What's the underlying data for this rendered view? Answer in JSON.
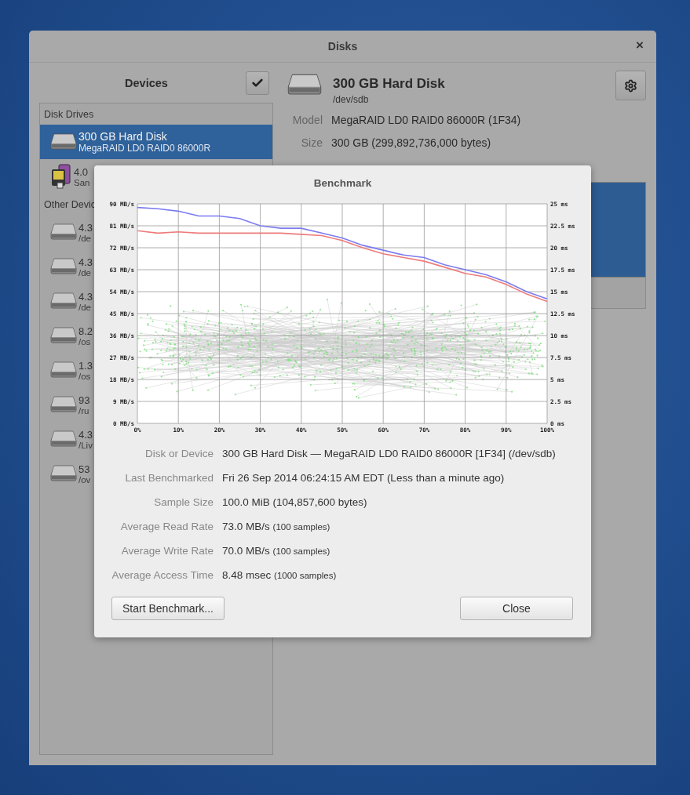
{
  "window": {
    "title": "Disks",
    "close_glyph": "×"
  },
  "sidebar": {
    "title": "Devices",
    "sections": [
      {
        "header": "Disk Drives",
        "items": [
          {
            "kind": "disk",
            "name": "300 GB Hard Disk",
            "detail": "MegaRAID LD0 RAID0 86000R",
            "selected": true
          },
          {
            "kind": "card-reader",
            "name": "4.0",
            "detail": "San",
            "selected": false
          }
        ]
      },
      {
        "header": "Other Devic",
        "items": [
          {
            "kind": "disk",
            "name": "4.3",
            "detail": "/de",
            "selected": false
          },
          {
            "kind": "disk",
            "name": "4.3",
            "detail": "/de",
            "selected": false
          },
          {
            "kind": "disk",
            "name": "4.3",
            "detail": "/de",
            "selected": false
          },
          {
            "kind": "disk",
            "name": "8.2",
            "detail": "/os",
            "selected": false
          },
          {
            "kind": "disk",
            "name": "1.3",
            "detail": "/os",
            "selected": false
          },
          {
            "kind": "disk",
            "name": "93",
            "detail": "/ru",
            "selected": false
          },
          {
            "kind": "disk",
            "name": "4.3",
            "detail": "/Liv",
            "selected": false
          },
          {
            "kind": "disk",
            "name": "53",
            "detail": "/ov",
            "selected": false
          }
        ]
      }
    ]
  },
  "drive": {
    "title": "300 GB Hard Disk",
    "path": "/dev/sdb",
    "properties": [
      {
        "label": "Model",
        "value": "MegaRAID LD0 RAID0 86000R (1F34)"
      },
      {
        "label": "Size",
        "value": "300 GB (299,892,736,000 bytes)"
      }
    ]
  },
  "benchmark": {
    "title": "Benchmark",
    "chart_data": {
      "type": "line",
      "x": [
        0,
        5,
        10,
        15,
        20,
        25,
        30,
        35,
        40,
        45,
        50,
        55,
        60,
        65,
        70,
        75,
        80,
        85,
        90,
        95,
        100
      ],
      "series": [
        {
          "color": "#7b7bf0",
          "values": [
            88.5,
            88,
            87,
            85,
            85,
            84,
            81,
            80,
            80,
            78,
            76,
            73,
            71,
            69,
            68,
            65,
            63,
            61,
            58,
            54,
            51
          ]
        },
        {
          "color": "#ee7b7b",
          "values": [
            79,
            78,
            78.5,
            78,
            78,
            78,
            78,
            78,
            77.5,
            77,
            75,
            72,
            69.5,
            68,
            66.5,
            64,
            61.5,
            60,
            57,
            53,
            50
          ]
        }
      ],
      "xlim": [
        0,
        100
      ],
      "ylim": [
        0,
        90
      ],
      "grid": true,
      "xticks": [
        {
          "value": 0,
          "label": "0%"
        },
        {
          "value": 10,
          "label": "10%"
        },
        {
          "value": 20,
          "label": "20%"
        },
        {
          "value": 30,
          "label": "30%"
        },
        {
          "value": 40,
          "label": "40%"
        },
        {
          "value": 50,
          "label": "50%"
        },
        {
          "value": 60,
          "label": "60%"
        },
        {
          "value": 70,
          "label": "70%"
        },
        {
          "value": 80,
          "label": "80%"
        },
        {
          "value": 90,
          "label": "90%"
        },
        {
          "value": 100,
          "label": "100%"
        }
      ],
      "yticks": [
        {
          "value": 0,
          "label": "0 MB/s"
        },
        {
          "value": 9,
          "label": "9 MB/s"
        },
        {
          "value": 18,
          "label": "18 MB/s"
        },
        {
          "value": 27,
          "label": "27 MB/s"
        },
        {
          "value": 36,
          "label": "36 MB/s"
        },
        {
          "value": 45,
          "label": "45 MB/s"
        },
        {
          "value": 54,
          "label": "54 MB/s"
        },
        {
          "value": 63,
          "label": "63 MB/s"
        },
        {
          "value": 72,
          "label": "72 MB/s"
        },
        {
          "value": 81,
          "label": "81 MB/s"
        },
        {
          "value": 90,
          "label": "90 MB/s"
        }
      ]
    },
    "access_axis_labels": [
      "25 ms",
      "22.5 ms",
      "20 ms",
      "17.5 ms",
      "15 ms",
      "12.5 ms",
      "10 ms",
      "7.5 ms",
      "5 ms",
      "2.5 ms",
      "0 ms"
    ],
    "details": [
      {
        "label": "Disk or Device",
        "value": "300 GB Hard Disk — MegaRAID LD0 RAID0 86000R [1F34] (/dev/sdb)"
      },
      {
        "label": "Last Benchmarked",
        "value": "Fri 26 Sep 2014 06:24:15 AM EDT (Less than a minute ago)"
      },
      {
        "label": "Sample Size",
        "value": "100.0 MiB (104,857,600 bytes)"
      },
      {
        "label": "Average Read Rate",
        "value": "73.0 MB/s",
        "note": "(100 samples)"
      },
      {
        "label": "Average Write Rate",
        "value": "70.0 MB/s",
        "note": "(100 samples)"
      },
      {
        "label": "Average Access Time",
        "value": "8.48 msec",
        "note": "(1000 samples)"
      }
    ],
    "buttons": {
      "start": "Start Benchmark...",
      "close": "Close"
    }
  }
}
